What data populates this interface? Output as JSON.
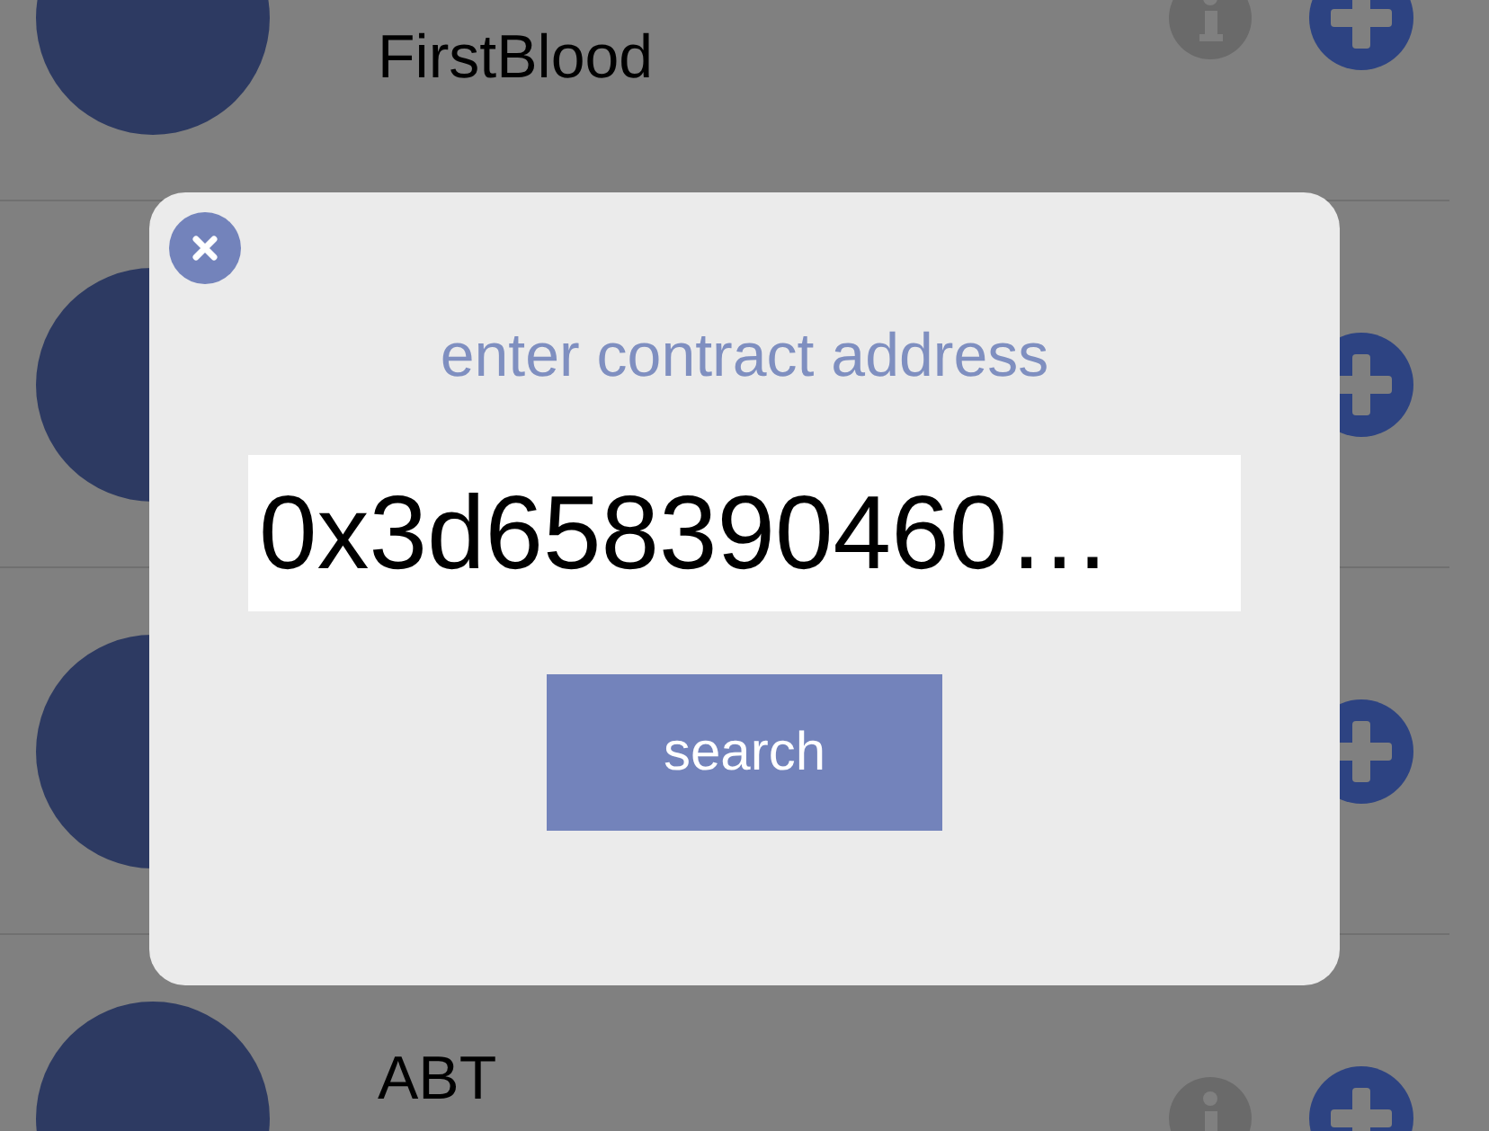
{
  "tokens": [
    {
      "name": "FirstBlood",
      "info_visible": true
    },
    {
      "info_visible": false
    },
    {
      "info_visible": false
    },
    {
      "symbol": "ABT",
      "info_visible": true
    }
  ],
  "dialog": {
    "title": "enter contract address",
    "address": {
      "value": "0x3d658390460…"
    },
    "button": "search"
  }
}
